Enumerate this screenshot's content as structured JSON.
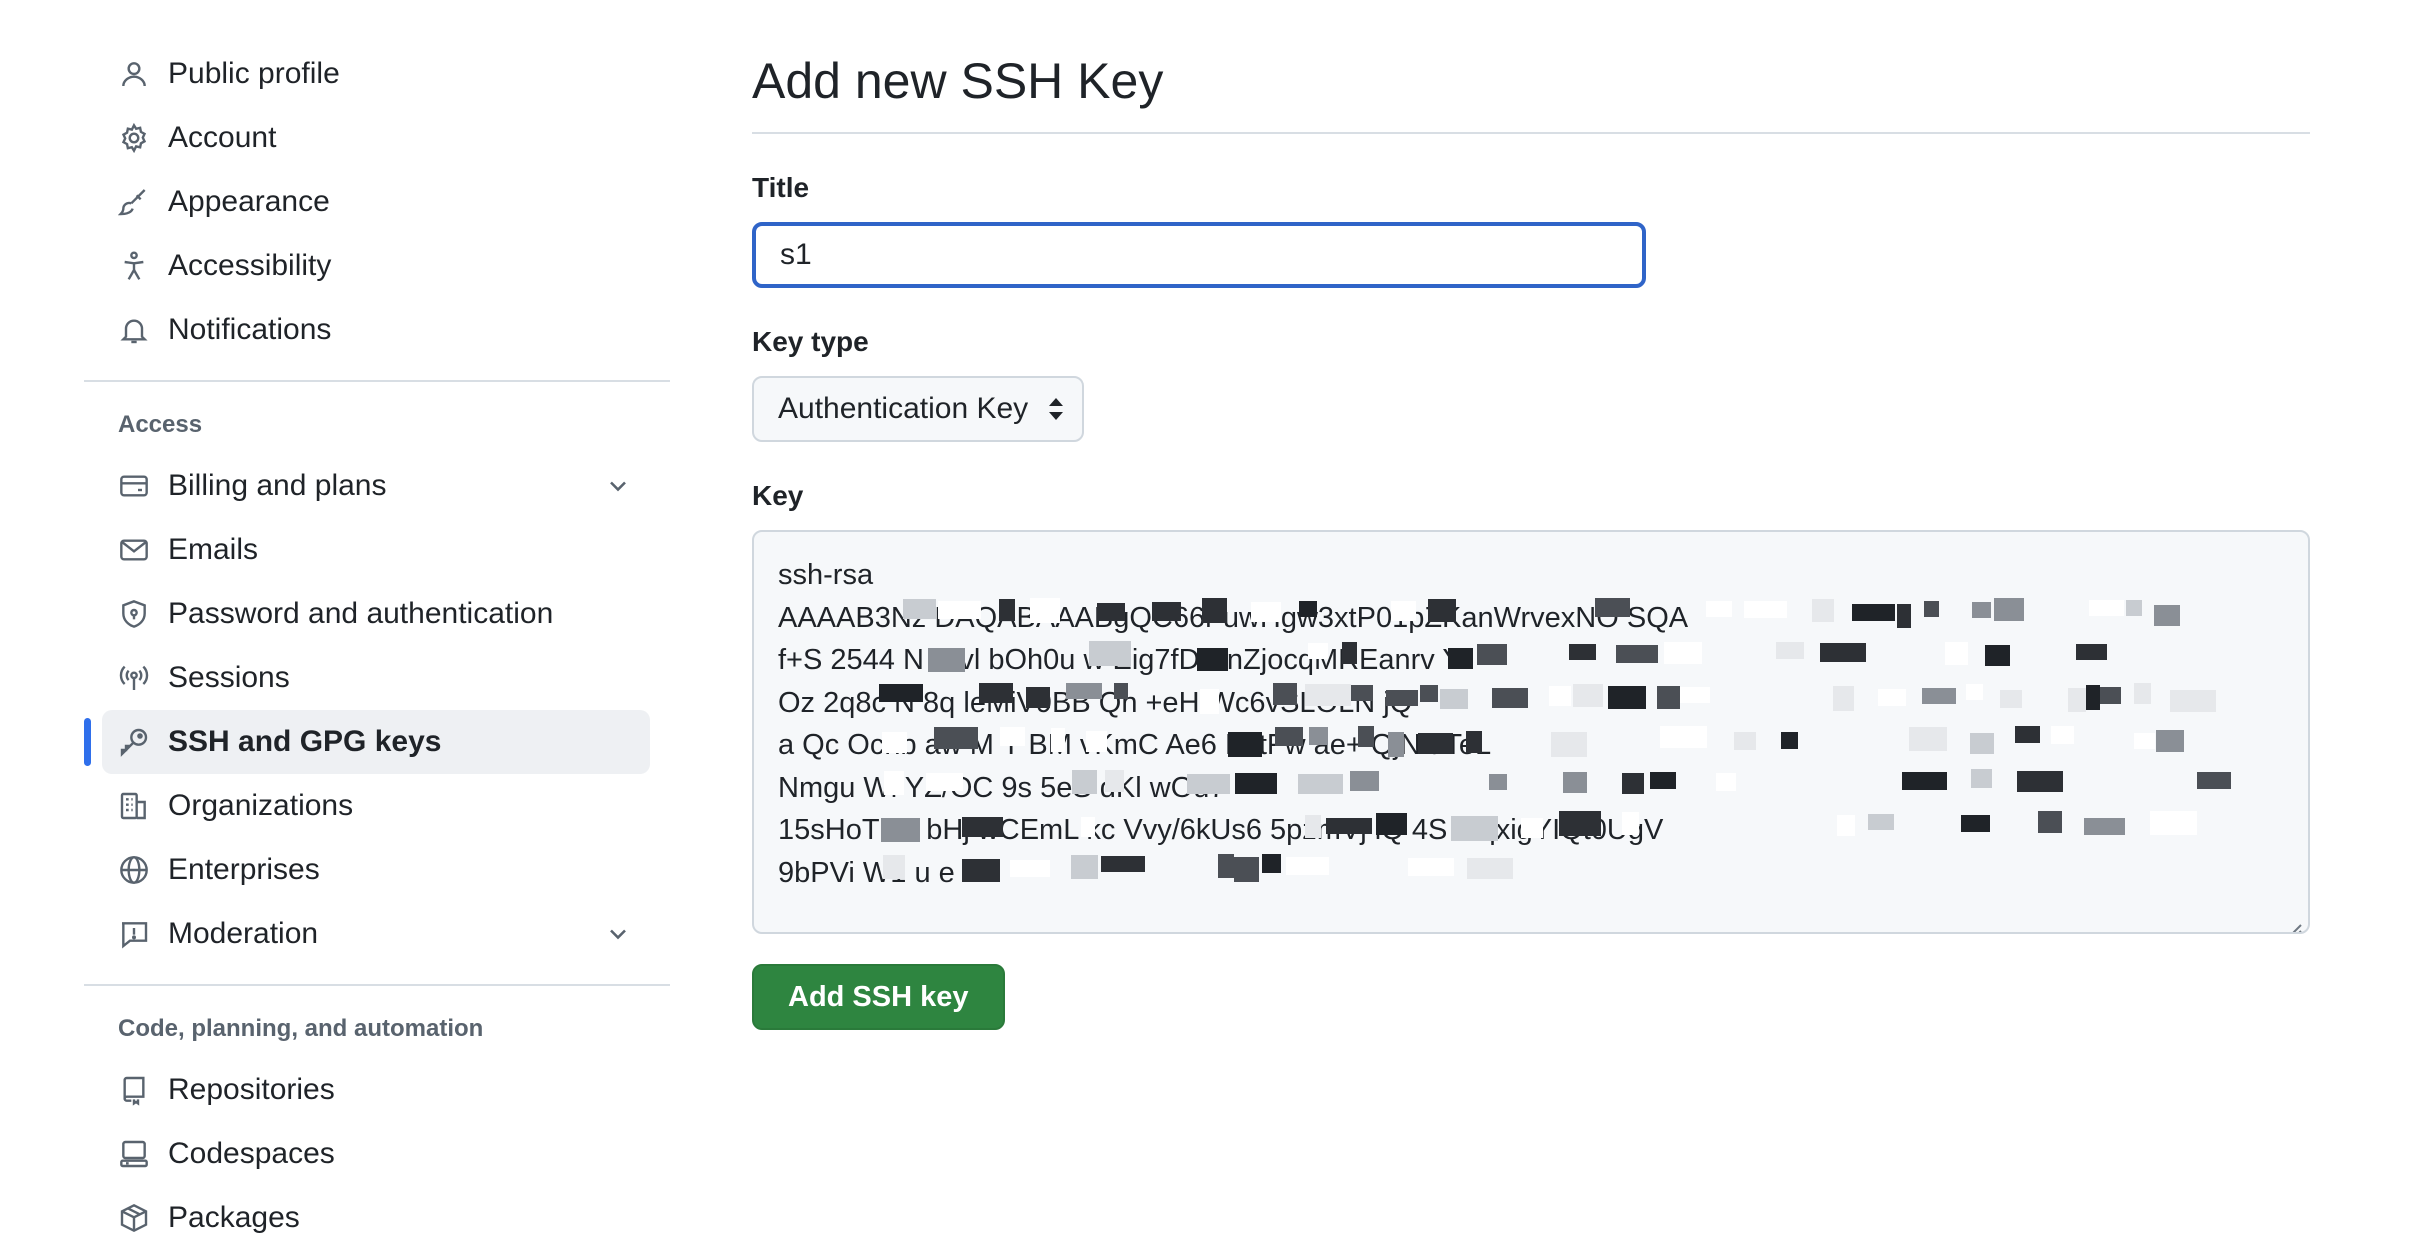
{
  "sidebar": {
    "top_items": [
      {
        "label": "Public profile",
        "icon": "person-icon"
      },
      {
        "label": "Account",
        "icon": "gear-icon"
      },
      {
        "label": "Appearance",
        "icon": "paintbrush-icon"
      },
      {
        "label": "Accessibility",
        "icon": "accessibility-icon"
      },
      {
        "label": "Notifications",
        "icon": "bell-icon"
      }
    ],
    "access_heading": "Access",
    "access_items": [
      {
        "label": "Billing and plans",
        "icon": "credit-card-icon",
        "expandable": true
      },
      {
        "label": "Emails",
        "icon": "mail-icon"
      },
      {
        "label": "Password and authentication",
        "icon": "shield-lock-icon"
      },
      {
        "label": "Sessions",
        "icon": "broadcast-icon"
      },
      {
        "label": "SSH and GPG keys",
        "icon": "key-icon",
        "active": true
      },
      {
        "label": "Organizations",
        "icon": "organization-icon"
      },
      {
        "label": "Enterprises",
        "icon": "globe-icon"
      },
      {
        "label": "Moderation",
        "icon": "report-icon",
        "expandable": true
      }
    ],
    "code_heading": "Code, planning, and automation",
    "code_items": [
      {
        "label": "Repositories",
        "icon": "repo-icon"
      },
      {
        "label": "Codespaces",
        "icon": "codespaces-icon"
      },
      {
        "label": "Packages",
        "icon": "package-icon"
      }
    ]
  },
  "main": {
    "title": "Add new SSH Key",
    "title_field": {
      "label": "Title",
      "value": "s1"
    },
    "key_type": {
      "label": "Key type",
      "selected": "Authentication Key"
    },
    "key_field": {
      "label": "Key",
      "lines": [
        "ssh-rsa",
        "AAAAB3Nz         DAQABAAABgQC66r           uwHgw3xtP01pZKanWrvexNO  SQA",
        "f+S          2544         N        E   vl  bOh0u      w         Eig7fDWnZjocqMREanrv  YI",
        "Oz 2q8c            N      8q        leMiV9BB   Qn    +eH          Wc6vSLOLN  jQ",
        "a    Qc  Ocnb  aw      M        Y   BM         vKmC      Ae6      KxtFw  ae+  QjN  t  TeL",
        "Nmgu              Wl    YZ/OC                             9s    5eS   dKl  wOu7",
        "  15sHoTmc           bHj  wCEmL  kc  Vvy/6kUs6   5pzmVj    iQ       4S      8tqxigYIQt0UgV",
        "9bPVi  W1                    u                 e"
      ]
    },
    "submit_label": "Add SSH key"
  },
  "colors": {
    "focus_border": "#2f64c8",
    "active_indicator": "#2f6feb",
    "submit_bg": "#2e8540"
  }
}
